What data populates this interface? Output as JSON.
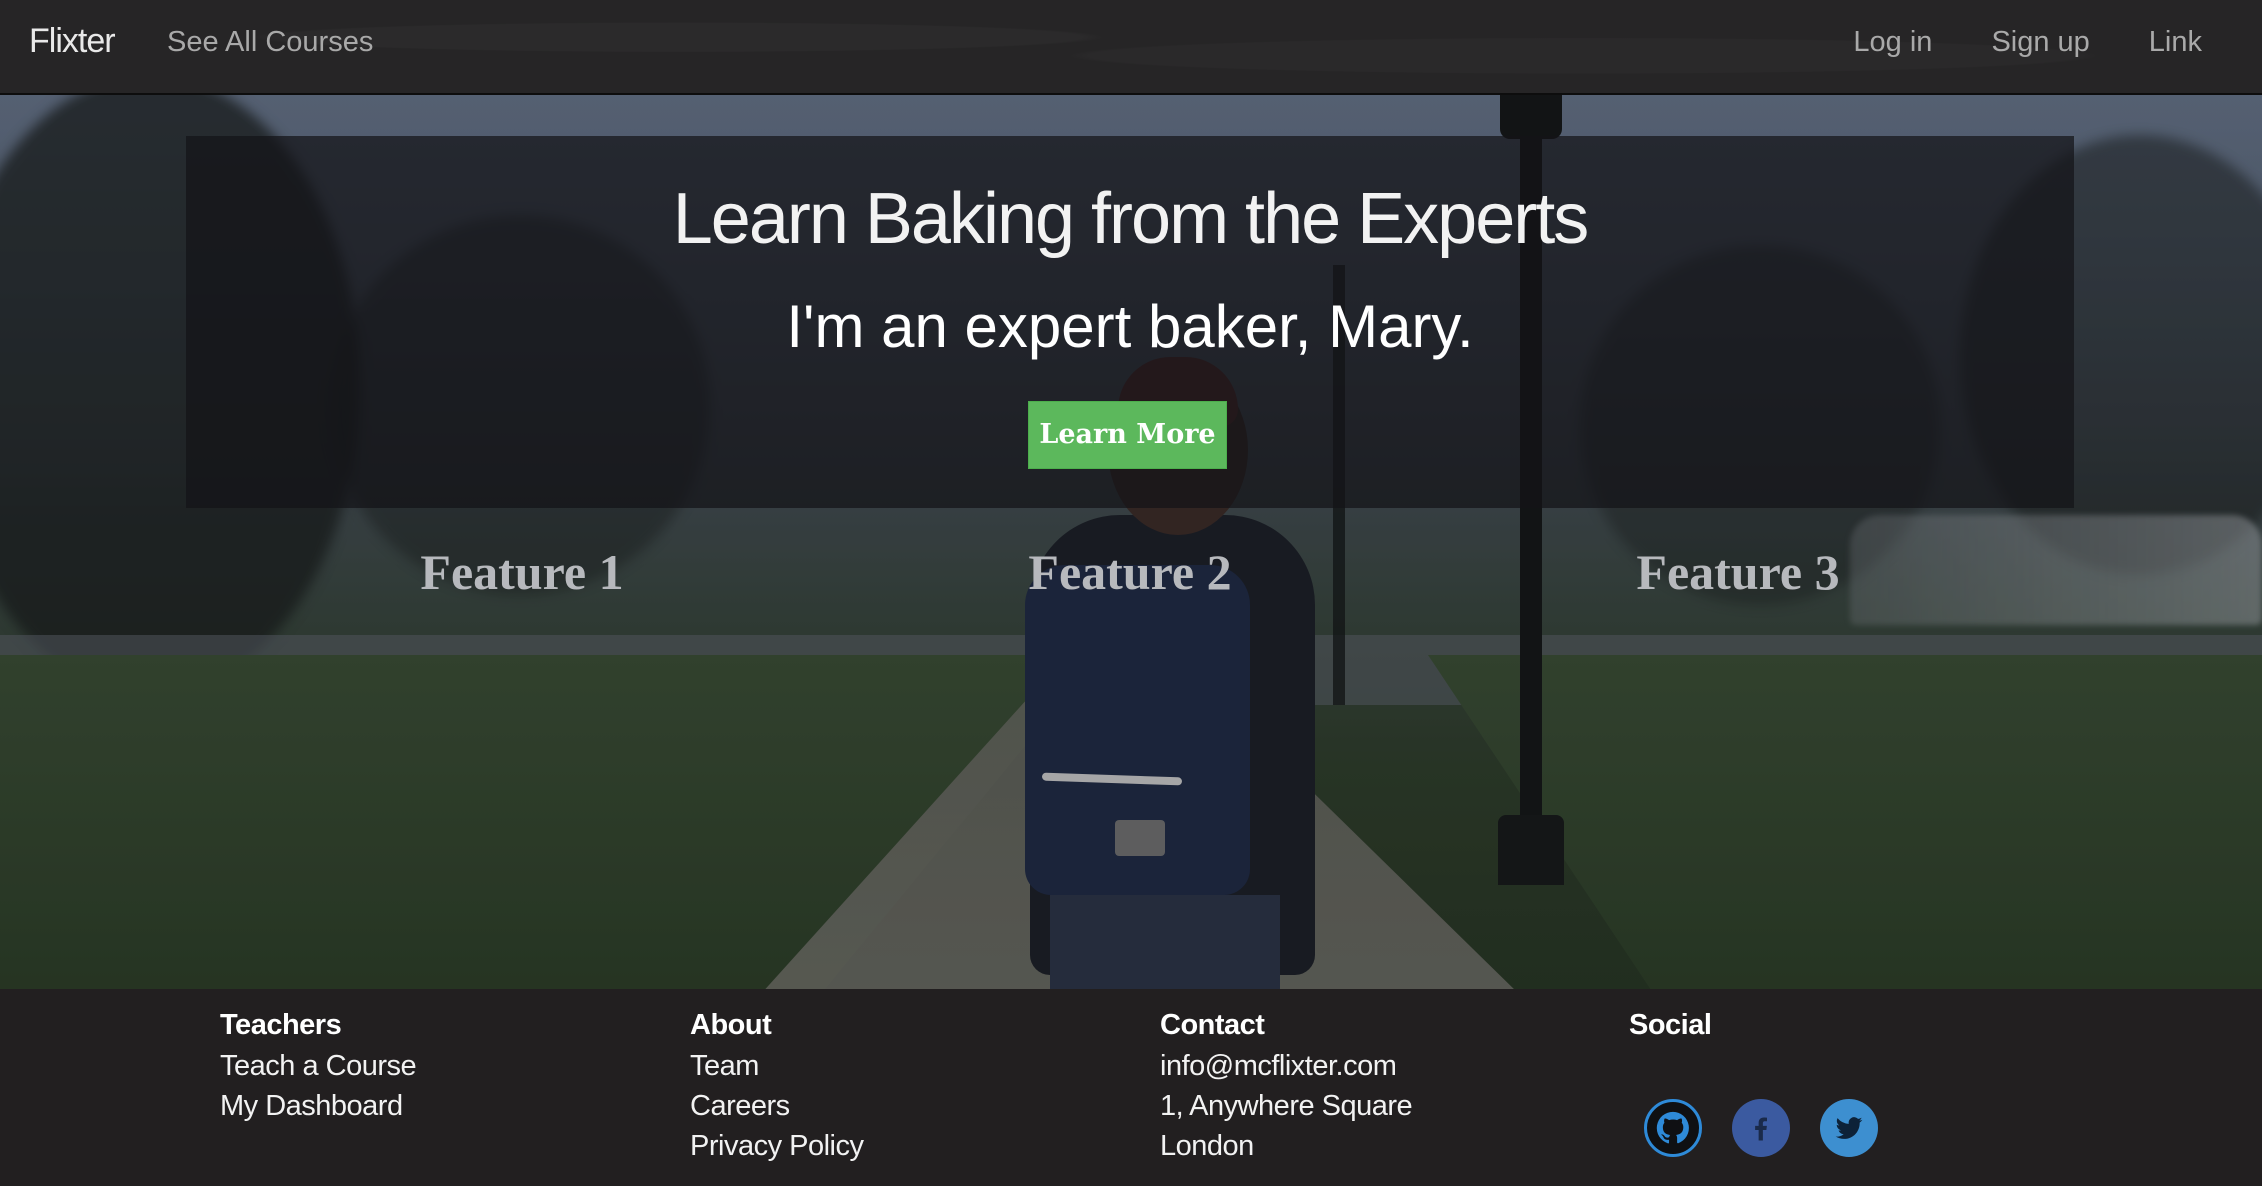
{
  "navbar": {
    "brand": "Flixter",
    "left_link": "See All Courses",
    "right_links": [
      "Log in",
      "Sign up",
      "Link"
    ]
  },
  "hero": {
    "title": "Learn Baking from the Experts",
    "subtitle": "I'm an expert baker, Mary.",
    "cta_label": "Learn More",
    "cta_color": "#5cb85c",
    "features": [
      "Feature 1",
      "Feature 2",
      "Feature 3"
    ]
  },
  "footer": {
    "teachers": {
      "heading": "Teachers",
      "items": [
        "Teach a Course",
        "My Dashboard"
      ]
    },
    "about": {
      "heading": "About",
      "items": [
        "Team",
        "Careers",
        "Privacy Policy"
      ]
    },
    "contact": {
      "heading": "Contact",
      "items": [
        "info@mcflixter.com",
        "1, Anywhere Square",
        "London"
      ]
    },
    "social": {
      "heading": "Social",
      "icons": [
        "github-icon",
        "facebook-icon",
        "twitter-icon"
      ]
    }
  }
}
